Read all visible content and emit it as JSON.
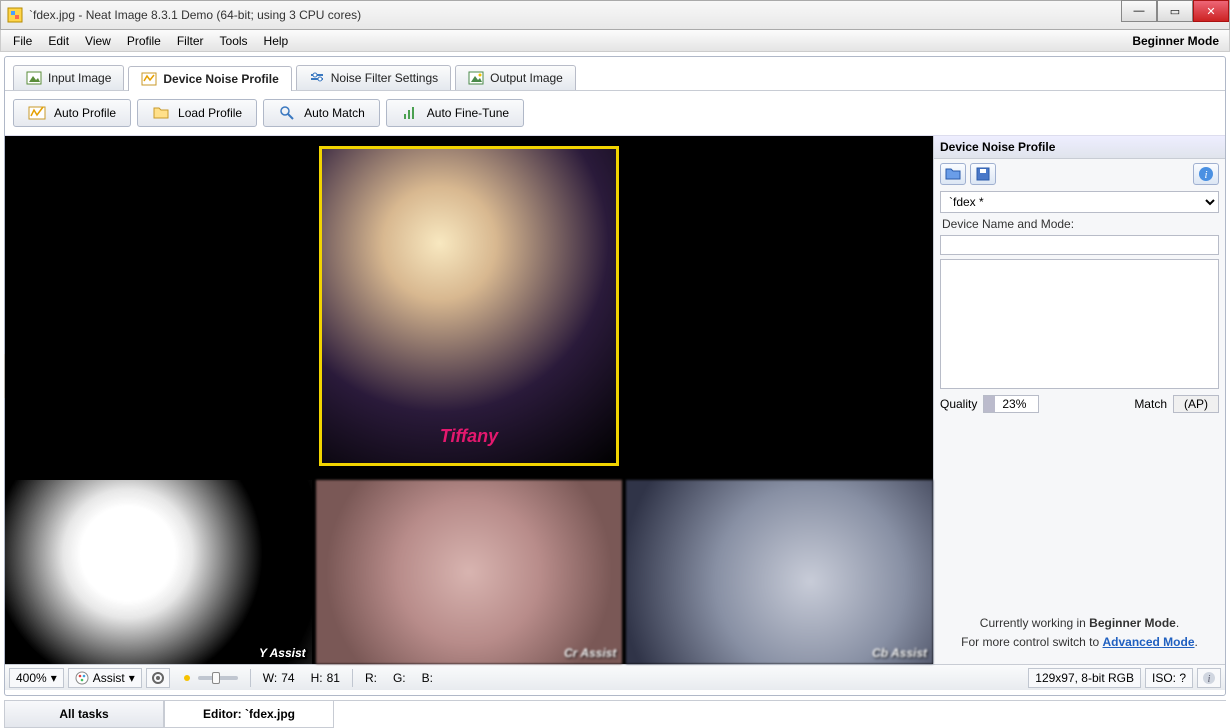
{
  "window": {
    "title": "`fdex.jpg - Neat Image 8.3.1 Demo (64-bit; using 3 CPU cores)"
  },
  "menu": {
    "items": [
      "File",
      "Edit",
      "View",
      "Profile",
      "Filter",
      "Tools",
      "Help"
    ],
    "mode_label": "Beginner Mode"
  },
  "tabs": [
    {
      "label": "Input Image"
    },
    {
      "label": "Device Noise Profile"
    },
    {
      "label": "Noise Filter Settings"
    },
    {
      "label": "Output Image"
    }
  ],
  "toolbar": {
    "auto_profile": "Auto Profile",
    "load_profile": "Load Profile",
    "auto_match": "Auto Match",
    "auto_finetune": "Auto Fine-Tune"
  },
  "assist": {
    "y": "Y Assist",
    "cr": "Cr Assist",
    "cb": "Cb Assist"
  },
  "panel": {
    "title": "Device Noise Profile",
    "profile_dropdown": "`fdex *",
    "device_label": "Device Name and Mode:",
    "device_value": "",
    "notes": "",
    "quality_label": "Quality",
    "quality_value": "23%",
    "match_label": "Match",
    "match_value": "(AP)",
    "hint_line1_a": "Currently working in ",
    "hint_line1_b": "Beginner Mode",
    "hint_line2_a": "For more control switch to ",
    "hint_line2_b": "Advanced Mode"
  },
  "status": {
    "zoom": "400%",
    "view_mode": "Assist",
    "w_label": "W:",
    "w": "74",
    "h_label": "H:",
    "h": "81",
    "r": "R:",
    "g": "G:",
    "b": "B:",
    "dims": "129x97, 8-bit RGB",
    "iso": "ISO: ?"
  },
  "bottom_tabs": {
    "all": "All tasks",
    "editor": "Editor: `fdex.jpg"
  }
}
